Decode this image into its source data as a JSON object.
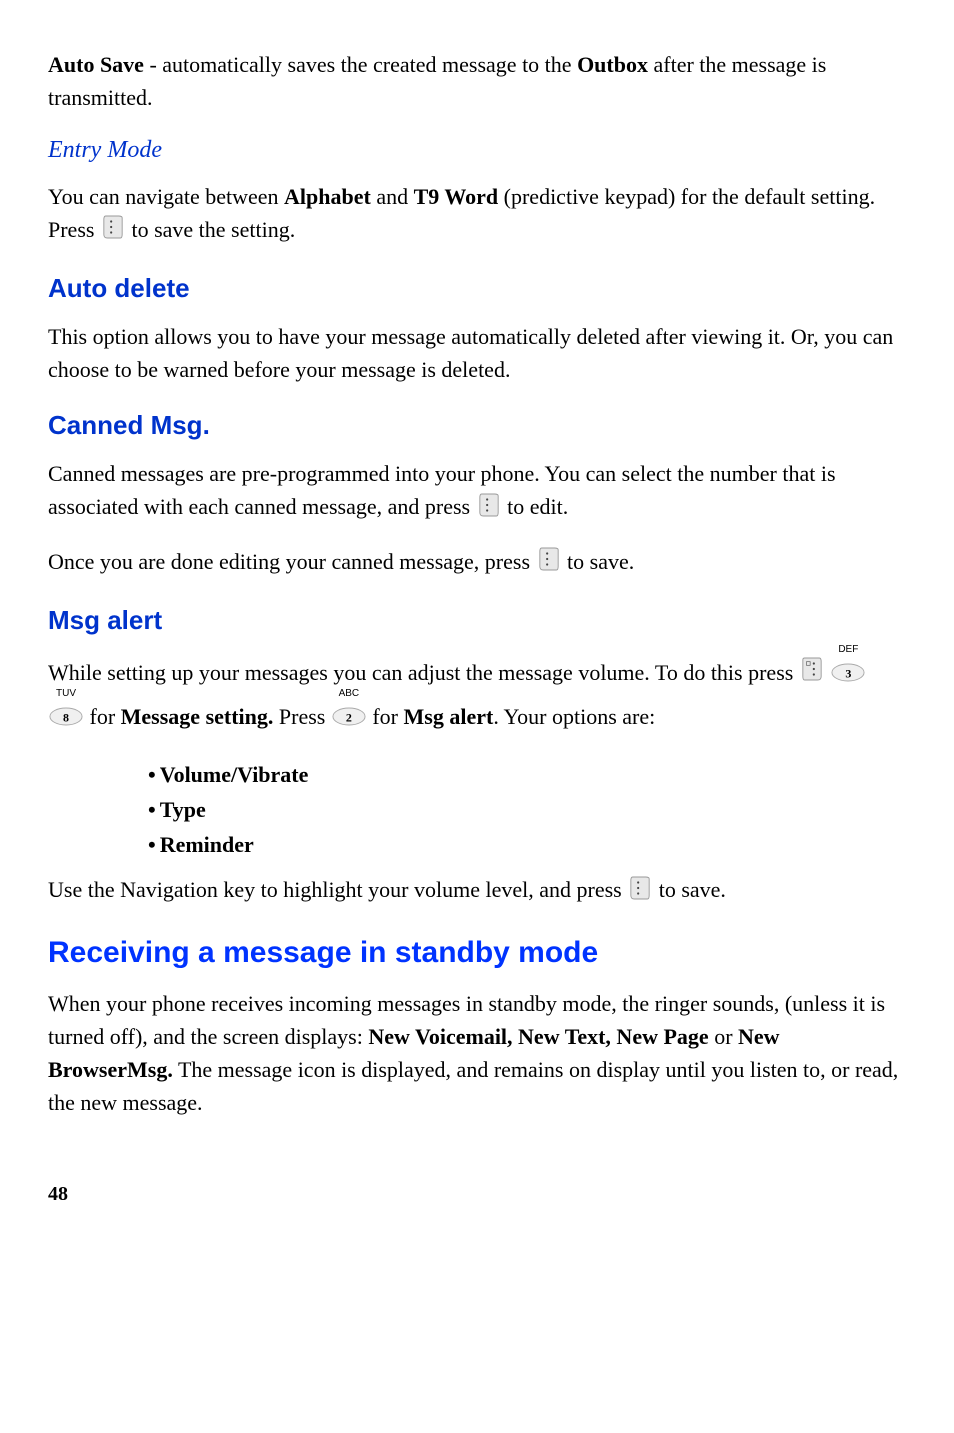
{
  "p1": {
    "a": "Auto Save",
    "b": " - automatically saves the created message to the ",
    "c": "Outbox",
    "d": " after the message is transmitted."
  },
  "h_entry": "Entry Mode",
  "p2": {
    "a": "You can navigate between ",
    "b": "Alphabet",
    "c": " and ",
    "d": "T9 Word",
    "e": " (predictive keypad) for the default setting. Press ",
    "f": " to save the setting."
  },
  "h_auto_delete": "Auto delete",
  "p3": "This option allows you to have your message automatically deleted after viewing it. Or, you can choose to be warned before your message is deleted.",
  "h_canned": "Canned Msg.",
  "p4": {
    "a": "Canned messages are pre-programmed into your phone. You can select the number that is associated with each canned message, and press ",
    "b": " to edit."
  },
  "p5": {
    "a": "Once you are done editing your canned message, press ",
    "b": " to save."
  },
  "h_msg_alert": "Msg alert",
  "p6": {
    "a": "While setting up your messages you can adjust the message volume. To do this press ",
    "b": " for ",
    "c": "Message setting.",
    "d": " Press ",
    "e": " for ",
    "f": "Msg alert",
    "g": ". Your options are:"
  },
  "bullets": {
    "0": "Volume/Vibrate",
    "1": "Type",
    "2": "Reminder"
  },
  "p7": {
    "a": "Use the Navigation key to highlight your volume level, and press ",
    "b": " to save."
  },
  "h_receiving": "Receiving a message in standby mode",
  "p8": {
    "a": "When your phone receives incoming messages in standby mode, the ringer sounds, (unless it is turned off), and the screen displays: ",
    "b": "New Voicemail, New Text, New Page",
    "c": " or ",
    "d": "New BrowserMsg.",
    "e": " The message icon is displayed, and remains on display until you listen to, or read, the new message."
  },
  "page_num": "48",
  "key_labels": {
    "3sup": "DEF",
    "3": "3",
    "8sup": "TUV",
    "8": "8",
    "2sup": "ABC",
    "2": "2"
  }
}
